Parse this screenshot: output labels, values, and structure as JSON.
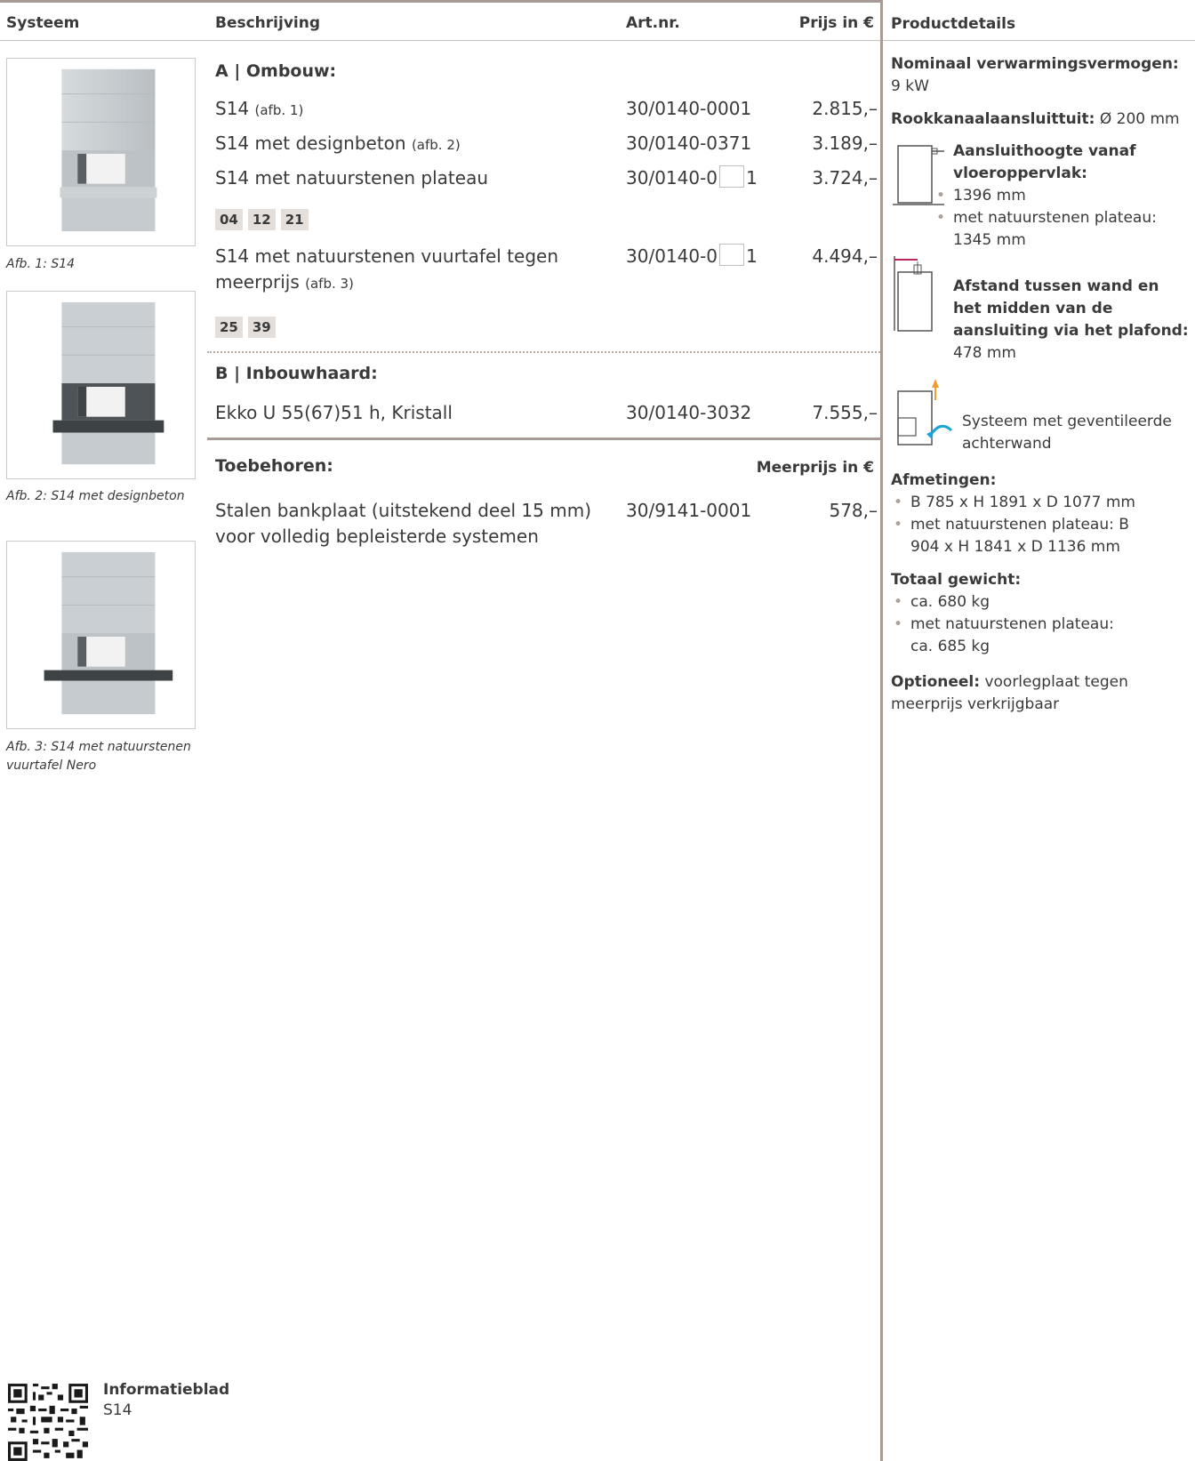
{
  "header": {
    "col_system": "Systeem",
    "col_description": "Beschrijving",
    "col_artnr": "Art.nr.",
    "col_price": "Prijs in €",
    "col_details": "Productdetails"
  },
  "figures": [
    {
      "caption": "Afb. 1: S14"
    },
    {
      "caption": "Afb. 2: S14 met designbeton"
    },
    {
      "caption": "Afb. 3: S14 met natuurstenen vuurtafel Nero"
    }
  ],
  "section_a": {
    "title": "A | Ombouw:",
    "rows": [
      {
        "desc": "S14",
        "note": "(afb. 1)",
        "art": "30/0140-0001",
        "price": "2.815,–"
      },
      {
        "desc": "S14 met designbeton",
        "note": "(afb. 2)",
        "art": "30/0140-0371",
        "price": "3.189,–"
      },
      {
        "desc": "S14 met natuurstenen plateau",
        "note": "",
        "art_pre": "30/0140-0",
        "art_post": "1",
        "price": "3.724,–"
      },
      {
        "desc": "S14 met natuurstenen vuurtafel tegen meerprijs",
        "note": "(afb. 3)",
        "art_pre": "30/0140-0",
        "art_post": "1",
        "price": "4.494,–"
      }
    ],
    "tags_1": [
      "04",
      "12",
      "21"
    ],
    "tags_2": [
      "25",
      "39"
    ]
  },
  "section_b": {
    "title": "B | Inbouwhaard:",
    "rows": [
      {
        "desc": "Ekko U 55(67)51 h, Kristall",
        "art": "30/0140-3032",
        "price": "7.555,–"
      }
    ]
  },
  "accessories": {
    "title": "Toebehoren:",
    "price_header": "Meerprijs in €",
    "rows": [
      {
        "desc": "Stalen bankplaat (uitstekend deel 15 mm) voor volledig bepleisterde systemen",
        "art": "30/9141-0001",
        "price": "578,–"
      }
    ]
  },
  "details": {
    "heating_label": "Nominaal verwarmingsvermogen:",
    "heating_value": "9 kW",
    "flue_label": "Rookkanaalaansluittuit:",
    "flue_value": "Ø 200 mm",
    "height_label": "Aansluithoogte vanaf vloeroppervlak:",
    "height_items": [
      "1396 mm",
      "met natuurstenen plateau: 1345 mm"
    ],
    "distance_label": "Afstand tussen wand en het midden van de aansluiting via het plafond:",
    "distance_value": "478 mm",
    "ventilated": "Systeem met geventileerde achterwand",
    "dimensions_label": "Afmetingen:",
    "dimensions_items": [
      "B 785 x H 1891 x D 1077 mm",
      "met natuurstenen plateau: B 904 x H 1841 x D 1136 mm"
    ],
    "weight_label": "Totaal gewicht:",
    "weight_items": [
      "ca. 680 kg",
      "met natuurstenen plateau: ca. 685 kg"
    ],
    "optional_label": "Optioneel:",
    "optional_value": "voorlegplaat tegen meerprijs verkrijgbaar"
  },
  "footer": {
    "title": "Informatieblad",
    "subtitle": "S14"
  },
  "colors": {
    "rule": "#a69c95",
    "tag_bg": "#e4dfdb",
    "text": "#3a3a3a",
    "accent_pink": "#c0245c",
    "accent_orange": "#f0a030",
    "accent_blue": "#1aa3d9"
  }
}
